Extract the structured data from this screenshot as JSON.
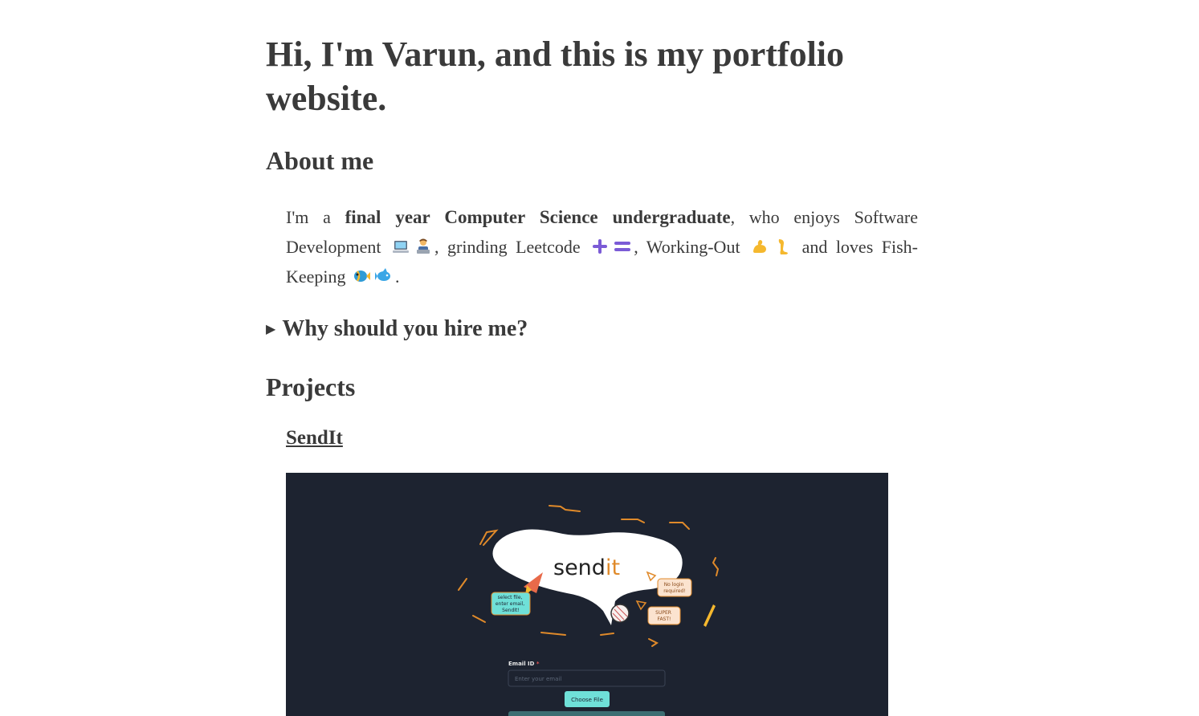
{
  "header": {
    "title": "Hi, I'm Varun, and this is my portfolio website."
  },
  "about": {
    "heading": "About me",
    "intro": "I'm a",
    "highlight": "final year Computer Science undergraduate",
    "text1": ", who enjoys Software Development",
    "text2": ", grinding Leetcode",
    "text3": ", Working-Out",
    "text4": "and loves Fish-Keeping",
    "text5": "."
  },
  "hire": {
    "summary": "Why should you hire me?"
  },
  "projects": {
    "heading": "Projects",
    "items": [
      {
        "name": "SendIt",
        "preview": {
          "logo_text_a": "send",
          "logo_text_b": "it",
          "bubble_left": [
            "select file,",
            "enter email,",
            "SendIt!"
          ],
          "bubble_top_right": [
            "No login",
            "required!"
          ],
          "bubble_bottom_right": [
            "SUPER",
            "FAST!"
          ],
          "email_label": "Email ID",
          "email_required_mark": "*",
          "email_placeholder": "Enter your email",
          "choose_file_label": "Choose File"
        }
      }
    ]
  },
  "colors": {
    "text": "#3a3a3a",
    "shot_bg": "#1d2330",
    "accent_orange": "#e08a2a",
    "accent_teal": "#6fe0d8",
    "emoji_purple": "#7b5bd6"
  },
  "icons": [
    "laptop-icon",
    "technologist-icon",
    "plus-icon",
    "equals-icon",
    "flexed-bicep-icon",
    "leg-icon",
    "tropical-fish-icon",
    "fish-icon",
    "disclosure-triangle-icon"
  ]
}
